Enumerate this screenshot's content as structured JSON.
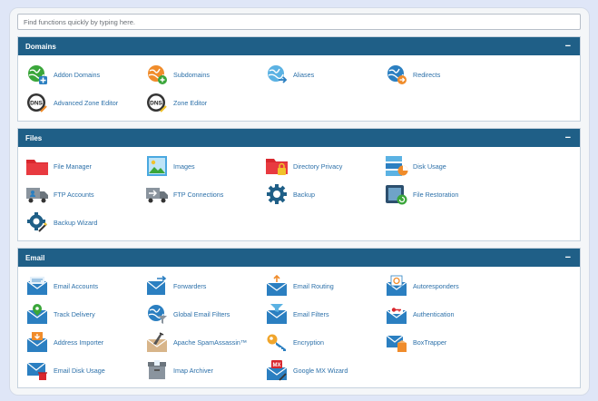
{
  "search": {
    "placeholder": "Find functions quickly by typing here."
  },
  "collapse_symbol": "−",
  "domains": {
    "title": "Domains",
    "items": [
      {
        "label": "Addon Domains"
      },
      {
        "label": "Subdomains"
      },
      {
        "label": "Aliases"
      },
      {
        "label": "Redirects"
      },
      {
        "label": "Advanced Zone Editor"
      },
      {
        "label": "Zone Editor"
      }
    ]
  },
  "files": {
    "title": "Files",
    "items": [
      {
        "label": "File Manager"
      },
      {
        "label": "Images"
      },
      {
        "label": "Directory Privacy"
      },
      {
        "label": "Disk Usage"
      },
      {
        "label": "FTP Accounts"
      },
      {
        "label": "FTP Connections"
      },
      {
        "label": "Backup"
      },
      {
        "label": "File Restoration"
      },
      {
        "label": "Backup Wizard"
      }
    ]
  },
  "email": {
    "title": "Email",
    "items": [
      {
        "label": "Email Accounts"
      },
      {
        "label": "Forwarders"
      },
      {
        "label": "Email Routing"
      },
      {
        "label": "Autoresponders"
      },
      {
        "label": "Track Delivery"
      },
      {
        "label": "Global Email Filters"
      },
      {
        "label": "Email Filters"
      },
      {
        "label": "Authentication"
      },
      {
        "label": "Address Importer"
      },
      {
        "label": "Apache SpamAssassin™"
      },
      {
        "label": "Encryption"
      },
      {
        "label": "BoxTrapper"
      },
      {
        "label": "Email Disk Usage"
      },
      {
        "label": "Imap Archiver"
      },
      {
        "label": "Google MX Wizard"
      }
    ]
  },
  "icon_text": {
    "dns": "DNS",
    "mx": "MX"
  },
  "colors": {
    "header": "#1f5f87",
    "link": "#2c70a9",
    "green": "#3aa63a",
    "orange": "#f08c2b",
    "blue": "#2b7fc1",
    "red": "#d9272e"
  }
}
